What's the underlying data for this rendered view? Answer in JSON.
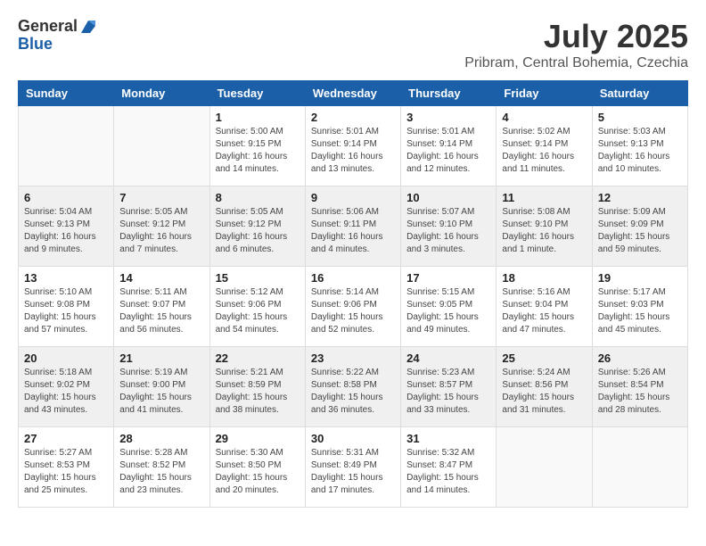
{
  "logo": {
    "general": "General",
    "blue": "Blue"
  },
  "title": "July 2025",
  "location": "Pribram, Central Bohemia, Czechia",
  "weekdays": [
    "Sunday",
    "Monday",
    "Tuesday",
    "Wednesday",
    "Thursday",
    "Friday",
    "Saturday"
  ],
  "weeks": [
    [
      {
        "day": "",
        "info": ""
      },
      {
        "day": "",
        "info": ""
      },
      {
        "day": "1",
        "info": "Sunrise: 5:00 AM\nSunset: 9:15 PM\nDaylight: 16 hours\nand 14 minutes."
      },
      {
        "day": "2",
        "info": "Sunrise: 5:01 AM\nSunset: 9:14 PM\nDaylight: 16 hours\nand 13 minutes."
      },
      {
        "day": "3",
        "info": "Sunrise: 5:01 AM\nSunset: 9:14 PM\nDaylight: 16 hours\nand 12 minutes."
      },
      {
        "day": "4",
        "info": "Sunrise: 5:02 AM\nSunset: 9:14 PM\nDaylight: 16 hours\nand 11 minutes."
      },
      {
        "day": "5",
        "info": "Sunrise: 5:03 AM\nSunset: 9:13 PM\nDaylight: 16 hours\nand 10 minutes."
      }
    ],
    [
      {
        "day": "6",
        "info": "Sunrise: 5:04 AM\nSunset: 9:13 PM\nDaylight: 16 hours\nand 9 minutes."
      },
      {
        "day": "7",
        "info": "Sunrise: 5:05 AM\nSunset: 9:12 PM\nDaylight: 16 hours\nand 7 minutes."
      },
      {
        "day": "8",
        "info": "Sunrise: 5:05 AM\nSunset: 9:12 PM\nDaylight: 16 hours\nand 6 minutes."
      },
      {
        "day": "9",
        "info": "Sunrise: 5:06 AM\nSunset: 9:11 PM\nDaylight: 16 hours\nand 4 minutes."
      },
      {
        "day": "10",
        "info": "Sunrise: 5:07 AM\nSunset: 9:10 PM\nDaylight: 16 hours\nand 3 minutes."
      },
      {
        "day": "11",
        "info": "Sunrise: 5:08 AM\nSunset: 9:10 PM\nDaylight: 16 hours\nand 1 minute."
      },
      {
        "day": "12",
        "info": "Sunrise: 5:09 AM\nSunset: 9:09 PM\nDaylight: 15 hours\nand 59 minutes."
      }
    ],
    [
      {
        "day": "13",
        "info": "Sunrise: 5:10 AM\nSunset: 9:08 PM\nDaylight: 15 hours\nand 57 minutes."
      },
      {
        "day": "14",
        "info": "Sunrise: 5:11 AM\nSunset: 9:07 PM\nDaylight: 15 hours\nand 56 minutes."
      },
      {
        "day": "15",
        "info": "Sunrise: 5:12 AM\nSunset: 9:06 PM\nDaylight: 15 hours\nand 54 minutes."
      },
      {
        "day": "16",
        "info": "Sunrise: 5:14 AM\nSunset: 9:06 PM\nDaylight: 15 hours\nand 52 minutes."
      },
      {
        "day": "17",
        "info": "Sunrise: 5:15 AM\nSunset: 9:05 PM\nDaylight: 15 hours\nand 49 minutes."
      },
      {
        "day": "18",
        "info": "Sunrise: 5:16 AM\nSunset: 9:04 PM\nDaylight: 15 hours\nand 47 minutes."
      },
      {
        "day": "19",
        "info": "Sunrise: 5:17 AM\nSunset: 9:03 PM\nDaylight: 15 hours\nand 45 minutes."
      }
    ],
    [
      {
        "day": "20",
        "info": "Sunrise: 5:18 AM\nSunset: 9:02 PM\nDaylight: 15 hours\nand 43 minutes."
      },
      {
        "day": "21",
        "info": "Sunrise: 5:19 AM\nSunset: 9:00 PM\nDaylight: 15 hours\nand 41 minutes."
      },
      {
        "day": "22",
        "info": "Sunrise: 5:21 AM\nSunset: 8:59 PM\nDaylight: 15 hours\nand 38 minutes."
      },
      {
        "day": "23",
        "info": "Sunrise: 5:22 AM\nSunset: 8:58 PM\nDaylight: 15 hours\nand 36 minutes."
      },
      {
        "day": "24",
        "info": "Sunrise: 5:23 AM\nSunset: 8:57 PM\nDaylight: 15 hours\nand 33 minutes."
      },
      {
        "day": "25",
        "info": "Sunrise: 5:24 AM\nSunset: 8:56 PM\nDaylight: 15 hours\nand 31 minutes."
      },
      {
        "day": "26",
        "info": "Sunrise: 5:26 AM\nSunset: 8:54 PM\nDaylight: 15 hours\nand 28 minutes."
      }
    ],
    [
      {
        "day": "27",
        "info": "Sunrise: 5:27 AM\nSunset: 8:53 PM\nDaylight: 15 hours\nand 25 minutes."
      },
      {
        "day": "28",
        "info": "Sunrise: 5:28 AM\nSunset: 8:52 PM\nDaylight: 15 hours\nand 23 minutes."
      },
      {
        "day": "29",
        "info": "Sunrise: 5:30 AM\nSunset: 8:50 PM\nDaylight: 15 hours\nand 20 minutes."
      },
      {
        "day": "30",
        "info": "Sunrise: 5:31 AM\nSunset: 8:49 PM\nDaylight: 15 hours\nand 17 minutes."
      },
      {
        "day": "31",
        "info": "Sunrise: 5:32 AM\nSunset: 8:47 PM\nDaylight: 15 hours\nand 14 minutes."
      },
      {
        "day": "",
        "info": ""
      },
      {
        "day": "",
        "info": ""
      }
    ]
  ]
}
